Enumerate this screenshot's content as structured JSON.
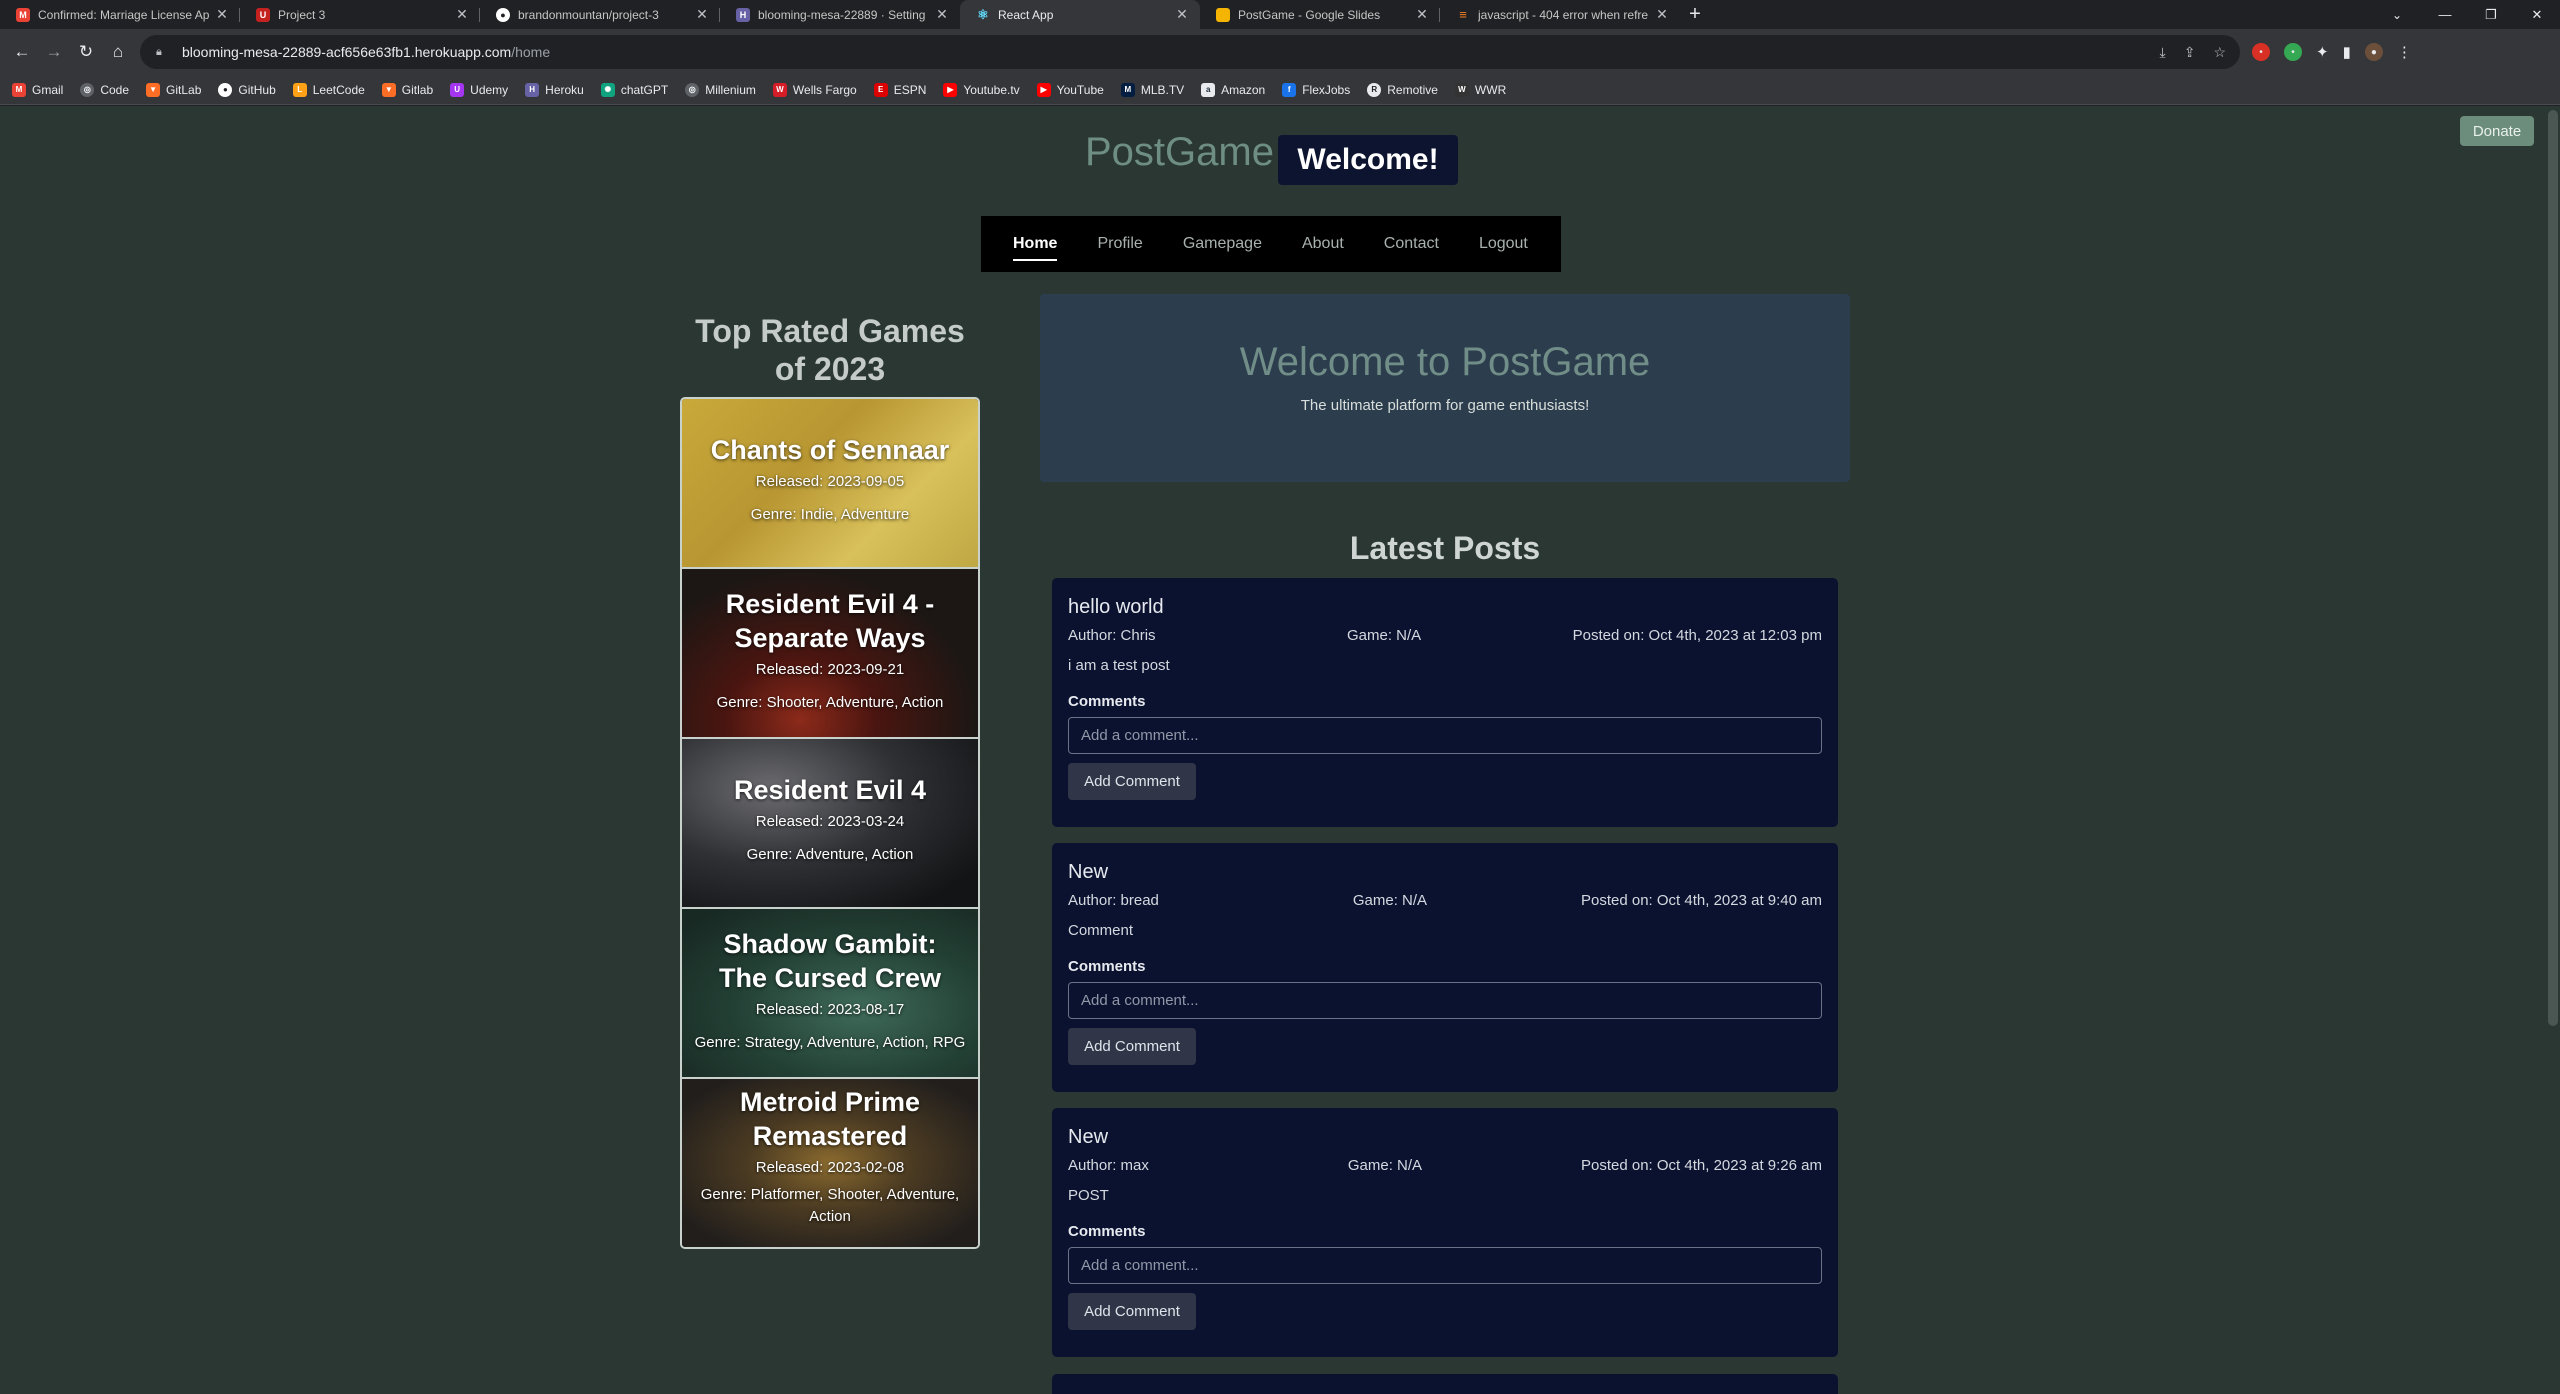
{
  "browser": {
    "tabs": [
      {
        "title": "Confirmed: Marriage License Ap",
        "icon": "gmail-icon",
        "color": "#ea4335",
        "active": false
      },
      {
        "title": "Project 3",
        "icon": "project-icon",
        "color": "#c5221f",
        "active": false
      },
      {
        "title": "brandonmountan/project-3",
        "icon": "github-icon",
        "color": "#ffffff",
        "active": false
      },
      {
        "title": "blooming-mesa-22889 · Setting",
        "icon": "heroku-icon",
        "color": "#6762a6",
        "active": false
      },
      {
        "title": "React App",
        "icon": "react-icon",
        "color": "#61dafb",
        "active": true
      },
      {
        "title": "PostGame - Google Slides",
        "icon": "slides-icon",
        "color": "#f4b400",
        "active": false
      },
      {
        "title": "javascript - 404 error when refre",
        "icon": "stackoverflow-icon",
        "color": "#f48024",
        "active": false
      }
    ],
    "url_host": "blooming-mesa-22889-acf656e63fb1.herokuapp.com",
    "url_path": "/home",
    "bookmarks": [
      {
        "label": "Gmail",
        "color": "#ea4335"
      },
      {
        "label": "Code",
        "color": "#5f6368"
      },
      {
        "label": "GitLab",
        "color": "#fc6d26"
      },
      {
        "label": "GitHub",
        "color": "#5f6368"
      },
      {
        "label": "LeetCode",
        "color": "#ffa116"
      },
      {
        "label": "Gitlab",
        "color": "#fc6d26"
      },
      {
        "label": "Udemy",
        "color": "#a435f0"
      },
      {
        "label": "Heroku",
        "color": "#6762a6"
      },
      {
        "label": "chatGPT",
        "color": "#10a37f"
      },
      {
        "label": "Millenium",
        "color": "#5f6368"
      },
      {
        "label": "Wells Fargo",
        "color": "#d71e28"
      },
      {
        "label": "ESPN",
        "color": "#d00"
      },
      {
        "label": "Youtube.tv",
        "color": "#ff0000"
      },
      {
        "label": "YouTube",
        "color": "#ff0000"
      },
      {
        "label": "MLB.TV",
        "color": "#041e42"
      },
      {
        "label": "Amazon",
        "color": "#232f3e"
      },
      {
        "label": "FlexJobs",
        "color": "#1a73e8"
      },
      {
        "label": "Remotive",
        "color": "#5f6368"
      },
      {
        "label": "WWR",
        "color": "#333333"
      }
    ]
  },
  "header": {
    "donate_label": "Donate",
    "brand": "PostGame",
    "welcome": "Welcome!"
  },
  "nav": {
    "items": [
      "Home",
      "Profile",
      "Gamepage",
      "About",
      "Contact",
      "Logout"
    ],
    "active": "Home"
  },
  "sidebar": {
    "title": "Top Rated Games of 2023",
    "games": [
      {
        "name": "Chants of Sennaar",
        "released": "Released: 2023-09-05",
        "genre": "Genre: Indie, Adventure"
      },
      {
        "name": "Resident Evil 4 - Separate Ways",
        "released": "Released: 2023-09-21",
        "genre": "Genre: Shooter, Adventure, Action"
      },
      {
        "name": "Resident Evil 4",
        "released": "Released: 2023-03-24",
        "genre": "Genre: Adventure, Action"
      },
      {
        "name": "Shadow Gambit: The Cursed Crew",
        "released": "Released: 2023-08-17",
        "genre": "Genre: Strategy, Adventure, Action, RPG"
      },
      {
        "name": "Metroid Prime Remastered",
        "released": "Released: 2023-02-08",
        "genre": "Genre: Platformer, Shooter, Adventure, Action"
      }
    ]
  },
  "hero": {
    "title": "Welcome to PostGame",
    "subtitle": "The ultimate platform for game enthusiasts!"
  },
  "posts_section": {
    "title": "Latest Posts",
    "posts": [
      {
        "title": "hello world",
        "author": "Author: Chris",
        "game": "Game: N/A",
        "posted": "Posted on: Oct 4th, 2023 at 12:03 pm",
        "body": "i am a test post",
        "comments_label": "Comments",
        "comment_placeholder": "Add a comment...",
        "button": "Add Comment"
      },
      {
        "title": "New",
        "author": "Author: bread",
        "game": "Game: N/A",
        "posted": "Posted on: Oct 4th, 2023 at 9:40 am",
        "body": "Comment",
        "comments_label": "Comments",
        "comment_placeholder": "Add a comment...",
        "button": "Add Comment"
      },
      {
        "title": "New",
        "author": "Author: max",
        "game": "Game: N/A",
        "posted": "Posted on: Oct 4th, 2023 at 9:26 am",
        "body": "POST",
        "comments_label": "Comments",
        "comment_placeholder": "Add a comment...",
        "button": "Add Comment"
      }
    ]
  }
}
